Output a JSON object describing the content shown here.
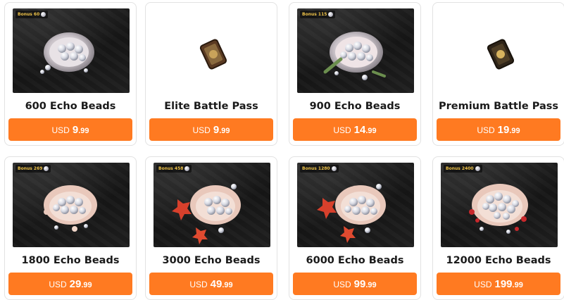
{
  "currency": "USD",
  "accent_color": "#ff7a21",
  "products": [
    {
      "name": "600 Echo Beads",
      "bonus": "Bonus 60",
      "price_int": "9",
      "price_dec": ".99",
      "image": "pearl-oyster-image",
      "dark": true
    },
    {
      "name": "Elite Battle Pass",
      "bonus": "",
      "price_int": "9",
      "price_dec": ".99",
      "image": "battle-pass-token-image",
      "dark": false
    },
    {
      "name": "900 Echo Beads",
      "bonus": "Bonus 115",
      "price_int": "14",
      "price_dec": ".99",
      "image": "pearl-oyster-image",
      "dark": true
    },
    {
      "name": "Premium Battle Pass",
      "bonus": "",
      "price_int": "19",
      "price_dec": ".99",
      "image": "battle-pass-token-image",
      "dark": false
    },
    {
      "name": "1800 Echo Beads",
      "bonus": "Bonus 269",
      "price_int": "29",
      "price_dec": ".99",
      "image": "pearl-oyster-image",
      "dark": true
    },
    {
      "name": "3000 Echo Beads",
      "bonus": "Bonus 458",
      "price_int": "49",
      "price_dec": ".99",
      "image": "pearl-oyster-maple-image",
      "dark": true
    },
    {
      "name": "6000 Echo Beads",
      "bonus": "Bonus 1280",
      "price_int": "99",
      "price_dec": ".99",
      "image": "pearl-oyster-maple-image",
      "dark": true
    },
    {
      "name": "12000 Echo Beads",
      "bonus": "Bonus 2400",
      "price_int": "199",
      "price_dec": ".99",
      "image": "pearl-oyster-red-image",
      "dark": true
    }
  ]
}
